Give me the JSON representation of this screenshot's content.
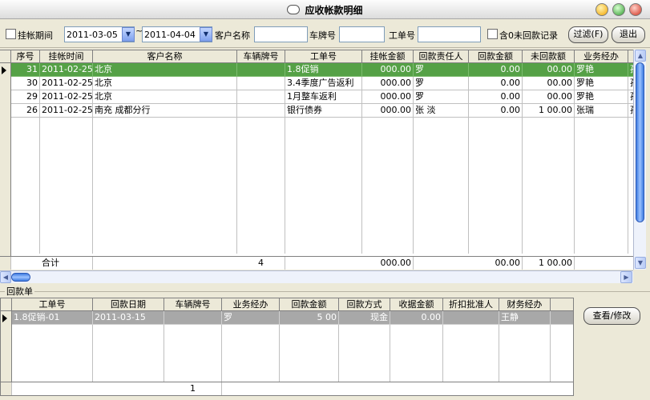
{
  "window": {
    "title": "应收帐款明细"
  },
  "toolbar": {
    "period_label": "挂帐期间",
    "date_from": "2011-03-05",
    "tilde": "~",
    "date_to": "2011-04-04",
    "customer_label": "客户名称",
    "customer_value": "",
    "plate_label": "车牌号",
    "plate_value": "",
    "order_label": "工单号",
    "order_value": "",
    "zero_label": "含0未回款记录",
    "filter_label": "过滤(F)",
    "exit_label": "退出"
  },
  "main_table": {
    "headers": [
      "序号",
      "挂帐时间",
      "客户名称",
      "车辆牌号",
      "工单号",
      "挂帐金额",
      "回款责任人",
      "回款金额",
      "未回款额",
      "业务经办",
      ""
    ],
    "rows": [
      [
        "31",
        "2011-02-25",
        "北京",
        "",
        "1.8促销",
        "000.00",
        "罗",
        "0.00",
        "00.00",
        "罗艳",
        "孩"
      ],
      [
        "30",
        "2011-02-25",
        "北京",
        "",
        "3.4季度广告返利",
        "000.00",
        "罗",
        "0.00",
        "00.00",
        "罗艳",
        "孩"
      ],
      [
        "29",
        "2011-02-25",
        "北京",
        "",
        "1月整车返利",
        "000.00",
        "罗",
        "0.00",
        "00.00",
        "罗艳",
        "孩"
      ],
      [
        "26",
        "2011-02-25",
        "南充                  成都分行",
        "",
        "银行债券",
        "000.00",
        "张     淡",
        "0.00",
        "1       00.00",
        "张瑞",
        "孩"
      ]
    ],
    "total": {
      "label": "合计",
      "plates": "4",
      "amount": "000.00",
      "paid": "00.00",
      "unpaid": "1       00.00"
    },
    "selected_row": 0
  },
  "payment": {
    "group_label": "回款单",
    "headers": [
      "工单号",
      "回款日期",
      "车辆牌号",
      "业务经办",
      "回款金额",
      "回款方式",
      "收据金额",
      "折扣批准人",
      "财务经办"
    ],
    "rows": [
      [
        "1.8促销-01",
        "2011-03-15",
        "",
        "罗",
        "5           00",
        "现金",
        "0.00",
        "",
        "王静"
      ]
    ],
    "total": {
      "plates": "1"
    },
    "view_button": "查看/修改"
  },
  "colors": {
    "selected_row": "#55a146",
    "header_bg": "#ece9d8",
    "scroll_thumb": "#3d7be0"
  },
  "icons": [
    "app-logo-icon",
    "minimize-icon",
    "maximize-icon",
    "close-icon",
    "dropdown-arrow-icon",
    "row-indicator-icon",
    "scroll-up-icon",
    "scroll-down-icon",
    "scroll-left-icon",
    "scroll-right-icon"
  ]
}
